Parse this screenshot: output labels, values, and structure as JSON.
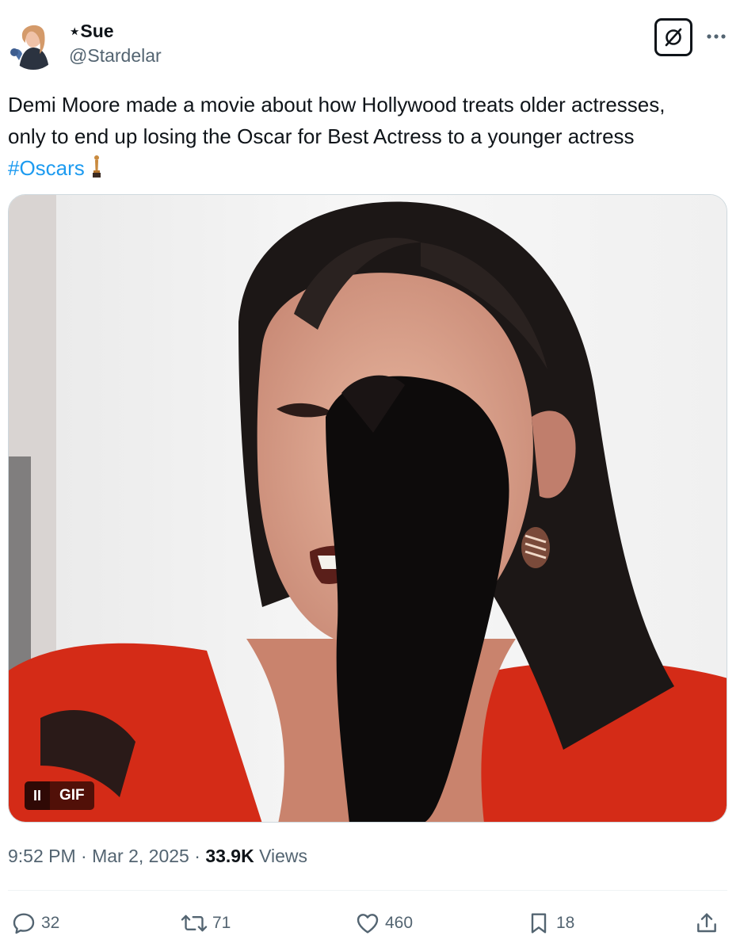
{
  "author": {
    "display_name": "⋆Sue",
    "handle": "@Stardelar",
    "avatar_icon": "avatar-illustration"
  },
  "header": {
    "grok_icon": "grok-slash-icon",
    "more_icon": "more-dots-icon"
  },
  "tweet": {
    "text_line1": "Demi Moore made a movie about how Hollywood treats older actresses,",
    "text_line2": "only to end up losing the Oscar for Best Actress to a younger actress",
    "hashtag": "#Oscars",
    "trophy_icon": "oscar-trophy-icon"
  },
  "media": {
    "type": "gif",
    "badge_pause": "II",
    "badge_label": "GIF"
  },
  "meta": {
    "time": "9:52 PM",
    "separator1": " · ",
    "date": "Mar 2, 2025",
    "separator2": " · ",
    "views_count": "33.9K",
    "views_label": " Views"
  },
  "actions": {
    "replies": "32",
    "reposts": "71",
    "likes": "460",
    "bookmarks": "18",
    "share_icon": "share-icon"
  },
  "colors": {
    "accent": "#1d9bf0",
    "text_primary": "#0f1419",
    "text_secondary": "#536471",
    "divider": "#eff3f4"
  }
}
